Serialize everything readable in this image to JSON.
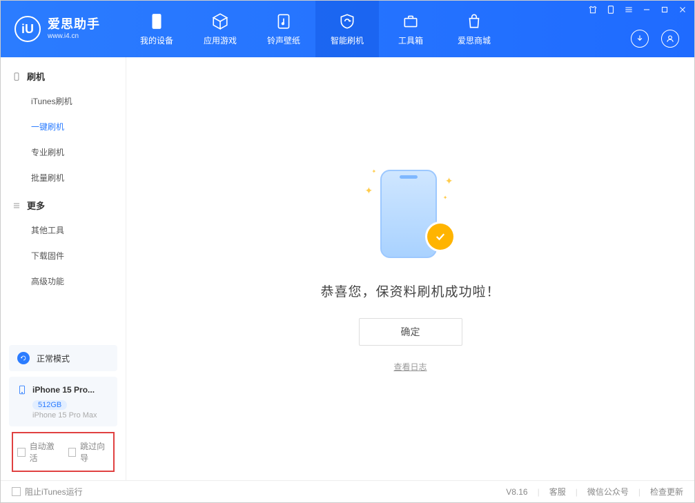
{
  "brand": {
    "title": "爱思助手",
    "subtitle": "www.i4.cn",
    "logo_text": "iU"
  },
  "nav": {
    "items": [
      {
        "label": "我的设备"
      },
      {
        "label": "应用游戏"
      },
      {
        "label": "铃声壁纸"
      },
      {
        "label": "智能刷机"
      },
      {
        "label": "工具箱"
      },
      {
        "label": "爱思商城"
      }
    ]
  },
  "sidebar": {
    "group1": {
      "title": "刷机",
      "items": [
        {
          "label": "iTunes刷机"
        },
        {
          "label": "一键刷机"
        },
        {
          "label": "专业刷机"
        },
        {
          "label": "批量刷机"
        }
      ]
    },
    "group2": {
      "title": "更多",
      "items": [
        {
          "label": "其他工具"
        },
        {
          "label": "下载固件"
        },
        {
          "label": "高级功能"
        }
      ]
    },
    "mode": {
      "label": "正常模式"
    },
    "device": {
      "name": "iPhone 15 Pro...",
      "storage": "512GB",
      "model": "iPhone 15 Pro Max"
    },
    "checks": {
      "auto_activate": "自动激活",
      "skip_wizard": "跳过向导"
    }
  },
  "main": {
    "success_text": "恭喜您，保资料刷机成功啦！",
    "ok_button": "确定",
    "view_log": "查看日志"
  },
  "footer": {
    "block_itunes": "阻止iTunes运行",
    "version": "V8.16",
    "support": "客服",
    "wechat": "微信公众号",
    "update": "检查更新"
  }
}
